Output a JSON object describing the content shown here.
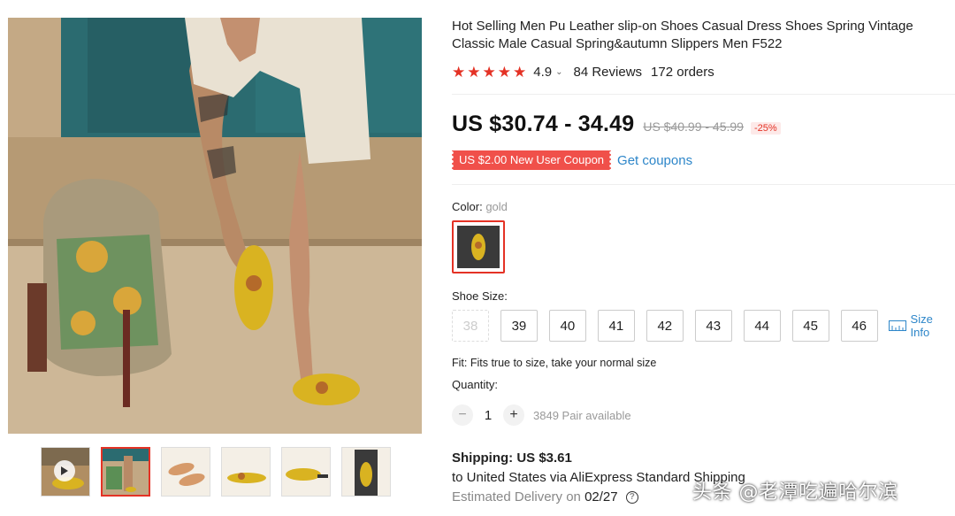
{
  "product": {
    "title": "Hot Selling Men Pu Leather slip-on Shoes Casual Dress Shoes Spring Vintage Classic Male Casual Spring&autumn Slippers Men F522",
    "rating": "4.9",
    "rating_caret": "⌄",
    "reviews": "84 Reviews",
    "orders": "172 orders",
    "stars": 5
  },
  "price": {
    "current": "US $30.74 - 34.49",
    "original": "US $40.99 - 45.99",
    "discount": "-25%"
  },
  "coupon": {
    "label": "US $2.00 New User Coupon",
    "link": "Get coupons"
  },
  "color": {
    "label": "Color:",
    "value": "gold"
  },
  "size": {
    "label": "Shoe Size:",
    "options": [
      "38",
      "39",
      "40",
      "41",
      "42",
      "43",
      "44",
      "45",
      "46"
    ],
    "disabled": [
      "38"
    ],
    "info": "Size Info"
  },
  "fit": "Fit: Fits true to size, take your normal size",
  "quantity": {
    "label": "Quantity:",
    "value": "1",
    "minus": "−",
    "plus": "+",
    "available": "3849 Pair available"
  },
  "shipping": {
    "cost": "Shipping: US $3.61",
    "route": "to United States via AliExpress Standard Shipping",
    "delivery_label": "Estimated Delivery on",
    "delivery_date": "02/27",
    "help": "?"
  },
  "watermark": "头条 @老潭吃遍哈尔滨",
  "colors": {
    "accent": "#e43225",
    "link": "#2d86c9",
    "coupon_bg": "#f0504a"
  }
}
